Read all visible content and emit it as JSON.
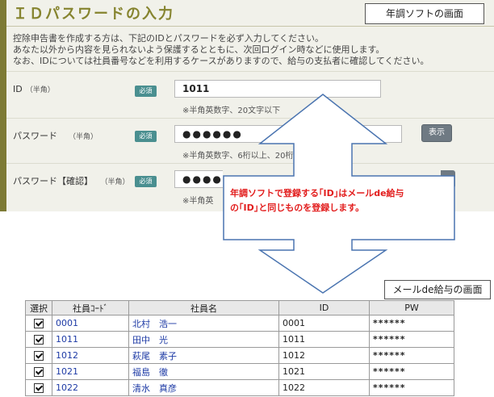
{
  "form": {
    "title": "ＩＤパスワードの入力",
    "intro_lines": [
      "控除申告書を作成する方は、下記のIDとパスワードを必ず入力してください。",
      "あなた以外から内容を見られないよう保護するとともに、次回ログイン時などに使用します。",
      "なお、IDについては社員番号などを利用するケースがありますので、給与の支払者に確認してください。"
    ],
    "required_badge": "必須",
    "id_field": {
      "label": "ID",
      "hint": "（半角）",
      "value": "1011",
      "note": "※半角英数字、20文字以下"
    },
    "password_field": {
      "label": "パスワード",
      "hint": "（半角）",
      "value": "●●●●●●",
      "note": "※半角英数字、6桁以上、20桁以下"
    },
    "password_confirm_field": {
      "label": "パスワード【確認】",
      "hint": "（半角）",
      "value": "●●●●●",
      "note": "※半角英"
    },
    "show_button": "表示"
  },
  "captions": {
    "nencho": "年調ソフトの画面",
    "mail": "メールde給与の画面"
  },
  "callout": {
    "line1": "年調ソフトで登録する｢ID｣はメールde給与",
    "line2": "の｢ID｣と同じものを登録します。"
  },
  "table": {
    "headers": [
      "選択",
      "社員ｺｰﾄﾞ",
      "社員名",
      "ID",
      "PW"
    ],
    "rows": [
      {
        "code": "0001",
        "name": "北村　浩一",
        "id": "0001",
        "pw": "******"
      },
      {
        "code": "1011",
        "name": "田中　光",
        "id": "1011",
        "pw": "******"
      },
      {
        "code": "1012",
        "name": "萩尾　素子",
        "id": "1012",
        "pw": "******"
      },
      {
        "code": "1021",
        "name": "福島　徹",
        "id": "1021",
        "pw": "******"
      },
      {
        "code": "1022",
        "name": "清水　真彦",
        "id": "1022",
        "pw": "******"
      }
    ]
  }
}
